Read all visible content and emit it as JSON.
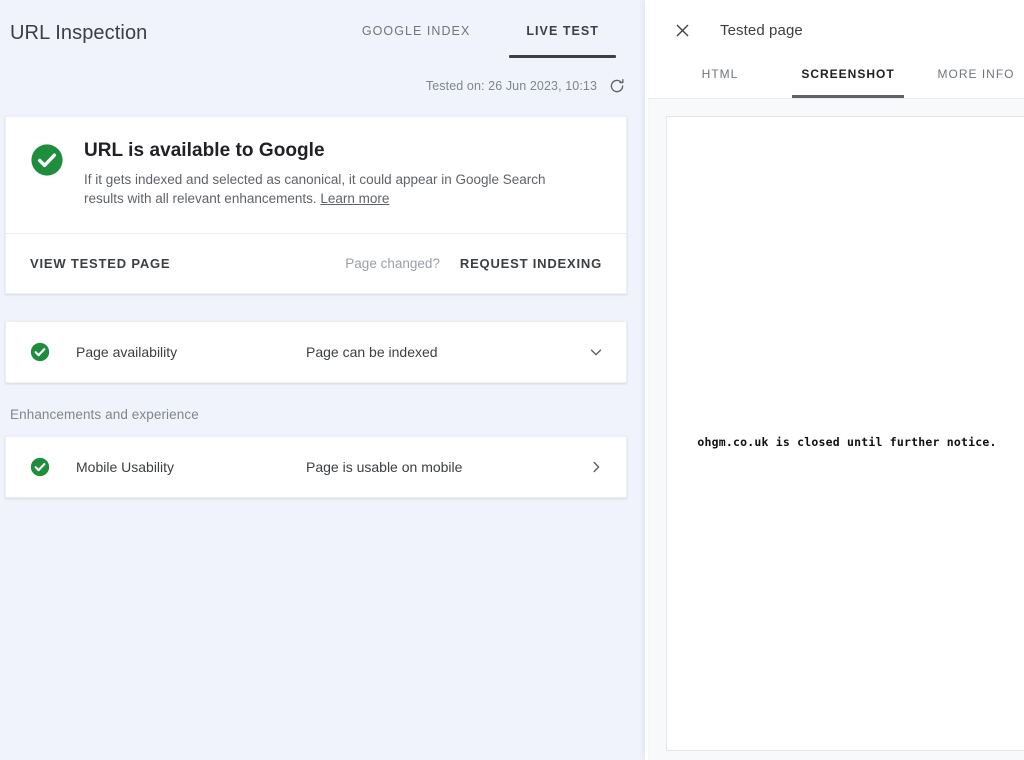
{
  "left": {
    "title": "URL Inspection",
    "tabs": [
      {
        "label": "GOOGLE INDEX",
        "active": false
      },
      {
        "label": "LIVE TEST",
        "active": true
      }
    ],
    "tested_on": "Tested on: 26 Jun 2023, 10:13",
    "refresh_icon": "refresh-icon",
    "status_card": {
      "icon": "success-check-icon",
      "title": "URL is available to Google",
      "description": "If it gets indexed and selected as canonical, it could appear in Google Search results with all relevant enhancements.",
      "learn_more": "Learn more",
      "view_tested_page": "VIEW TESTED PAGE",
      "page_changed": "Page changed?",
      "request_indexing": "REQUEST INDEXING"
    },
    "results": [
      {
        "icon": "success-check-icon",
        "label": "Page availability",
        "value": "Page can be indexed",
        "chevron": "chevron-down-icon"
      }
    ],
    "section_label": "Enhancements and experience",
    "enhancements": [
      {
        "icon": "success-check-icon",
        "label": "Mobile Usability",
        "value": "Page is usable on mobile",
        "chevron": "chevron-right-icon"
      }
    ]
  },
  "right": {
    "close_icon": "close-icon",
    "title": "Tested page",
    "tabs": [
      {
        "label": "HTML",
        "active": false
      },
      {
        "label": "SCREENSHOT",
        "active": true
      },
      {
        "label": "MORE INFO",
        "active": false
      }
    ],
    "screenshot_preview_text": "ohgm.co.uk is closed until further notice."
  },
  "colors": {
    "success_green": "#1e8e3e",
    "accent_dark": "#3c4043",
    "left_background": "#f0f3fc",
    "panel_background": "#f8f9fa",
    "muted_text": "#80868b"
  }
}
